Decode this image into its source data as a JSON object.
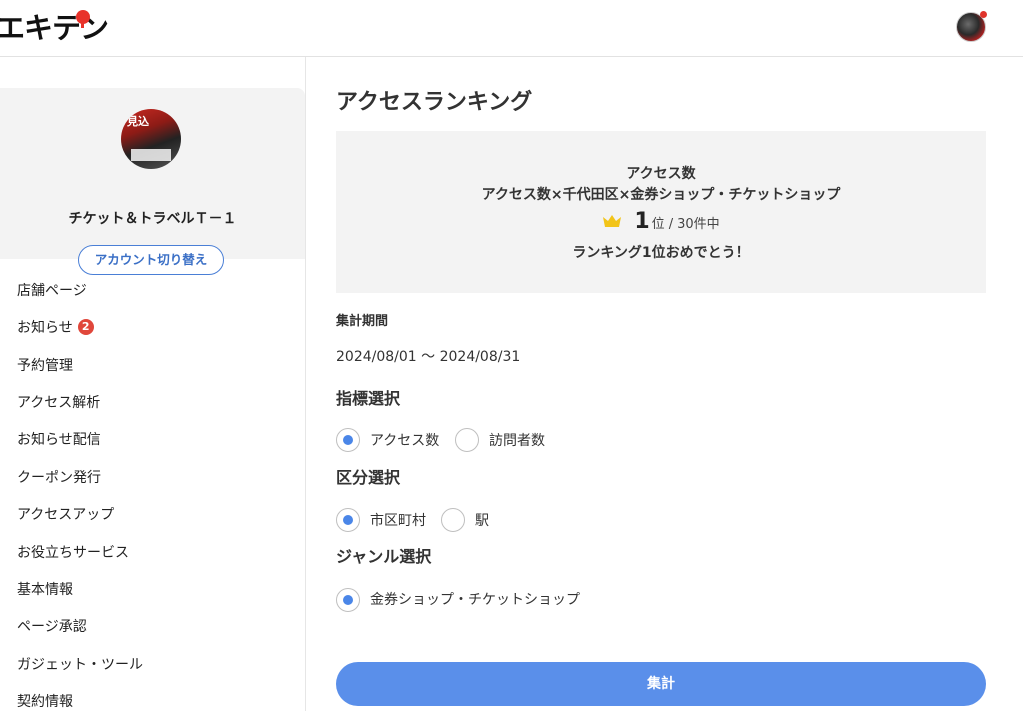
{
  "header": {
    "logo": "エキテン"
  },
  "sidebar": {
    "profile": {
      "name": "チケット＆トラベルＴ－１",
      "avatar_text": "見込",
      "switch_label": "アカウント切り替え"
    },
    "items": [
      {
        "label": "店舗ページ"
      },
      {
        "label": "お知らせ",
        "badge": "2"
      },
      {
        "label": "予約管理"
      },
      {
        "label": "アクセス解析"
      },
      {
        "label": "お知らせ配信"
      },
      {
        "label": "クーポン発行"
      },
      {
        "label": "アクセスアップ"
      },
      {
        "label": "お役立ちサービス"
      },
      {
        "label": "基本情報"
      },
      {
        "label": "ページ承認"
      },
      {
        "label": "ガジェット・ツール"
      },
      {
        "label": "契約情報"
      }
    ]
  },
  "main": {
    "title": "アクセスランキング",
    "result": {
      "metric": "アクセス数",
      "condition": "アクセス数×千代田区×金券ショップ・チケットショップ",
      "rank": "1",
      "rank_suffix": "位",
      "separator": "/",
      "total": "30件中",
      "congrats": "ランキング1位おめでとう！"
    },
    "period_label": "集計期間",
    "period_value": "2024/08/01 ～ 2024/08/31",
    "metric_section": {
      "title": "指標選択",
      "options": [
        {
          "label": "アクセス数",
          "checked": true
        },
        {
          "label": "訪問者数",
          "checked": false
        }
      ]
    },
    "area_section": {
      "title": "区分選択",
      "options": [
        {
          "label": "市区町村",
          "checked": true
        },
        {
          "label": "駅",
          "checked": false
        }
      ]
    },
    "genre_section": {
      "title": "ジャンル選択",
      "options": [
        {
          "label": "金券ショップ・チケットショップ",
          "checked": true
        }
      ]
    },
    "submit_label": "集計"
  },
  "colors": {
    "accent": "#5a8fea",
    "badge": "#e0473b",
    "crown": "#f2c418",
    "panel": "#f3f3f3"
  }
}
